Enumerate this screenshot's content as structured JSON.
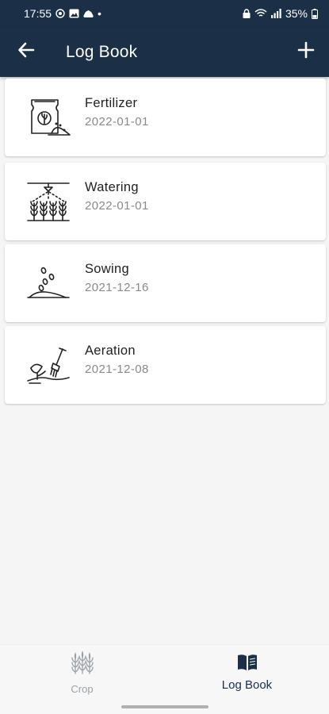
{
  "status_bar": {
    "time": "17:55",
    "dot": "•",
    "battery": "35%",
    "left_icons": [
      "chrome-icon",
      "image-icon",
      "cloud-icon"
    ],
    "right_icons": [
      "lock-icon",
      "wifi-icon",
      "signal-icon",
      "battery-icon"
    ]
  },
  "app_bar": {
    "title": "Log Book",
    "back_icon": "arrow-left-icon",
    "add_icon": "plus-icon",
    "color": "#1b2f47"
  },
  "log_entries": [
    {
      "title": "Fertilizer",
      "date": "2022-01-01",
      "icon": "fertilizer-bag-icon"
    },
    {
      "title": "Watering",
      "date": "2022-01-01",
      "icon": "watering-sprinkler-icon"
    },
    {
      "title": "Sowing",
      "date": "2021-12-16",
      "icon": "seeds-soil-icon"
    },
    {
      "title": "Aeration",
      "date": "2021-12-08",
      "icon": "aeration-tool-icon"
    }
  ],
  "bottom_nav": {
    "items": [
      {
        "label": "Crop",
        "icon": "crop-plants-icon",
        "active": false
      },
      {
        "label": "Log Book",
        "icon": "open-book-icon",
        "active": true
      }
    ]
  }
}
